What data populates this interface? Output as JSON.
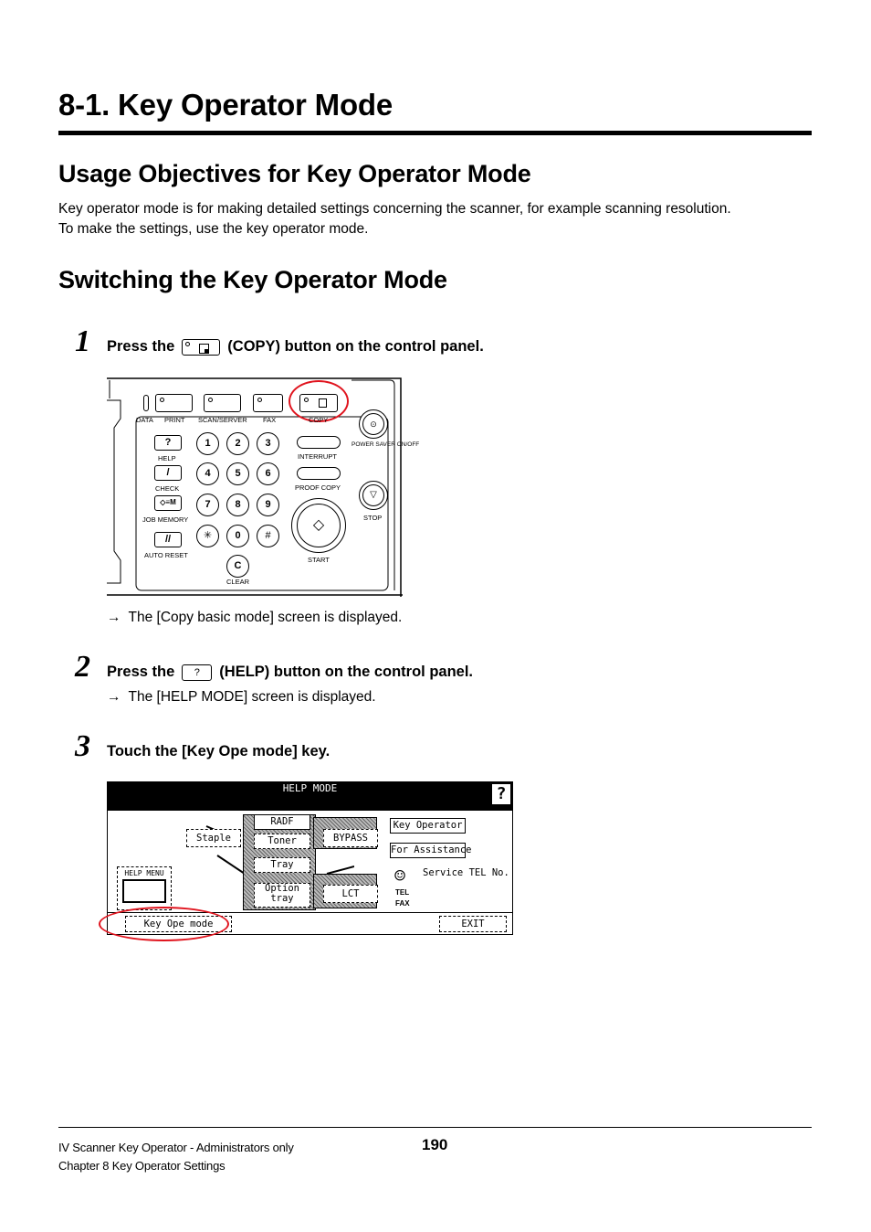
{
  "document": {
    "title": "8-1. Key Operator Mode",
    "sections": [
      {
        "heading": "Usage Objectives for Key Operator Mode",
        "paragraphs": [
          "Key operator mode is for making detailed settings concerning the scanner, for example scanning resolution.",
          "To make the settings, use the key operator mode."
        ]
      },
      {
        "heading": "Switching the Key Operator Mode"
      }
    ],
    "steps": [
      {
        "number": "1",
        "prefix": "Press the",
        "suffix": "(COPY) button on the control panel.",
        "icon": "copy-button-icon",
        "result": "The [Copy basic mode] screen is displayed."
      },
      {
        "number": "2",
        "prefix": "Press the",
        "key_label": "?",
        "suffix": "(HELP) button on the control panel.",
        "icon": "help-button-icon",
        "result": "The [HELP MODE] screen is displayed."
      },
      {
        "number": "3",
        "text": "Touch the [Key Ope mode] key."
      }
    ],
    "result_arrow": "→"
  },
  "control_panel": {
    "mode_keys": [
      "DATA",
      "PRINT",
      "SCAN/SERVER",
      "FAX",
      "COPY"
    ],
    "left_keys": [
      {
        "symbol": "?",
        "label": "HELP"
      },
      {
        "symbol": "/",
        "label": "CHECK"
      },
      {
        "symbol": "◇≡M",
        "label": "JOB MEMORY"
      },
      {
        "symbol": "//",
        "label": "AUTO RESET"
      }
    ],
    "keypad": [
      "1",
      "2",
      "3",
      "4",
      "5",
      "6",
      "7",
      "8",
      "9",
      "✳",
      "0",
      "#"
    ],
    "clear_key": {
      "symbol": "C",
      "label": "CLEAR"
    },
    "interrupt_label": "INTERRUPT",
    "proof_copy_label": "PROOF COPY",
    "start_label": "START",
    "start_symbol": "◇",
    "power_saver_label": "POWER SAVER ON/OFF",
    "stop_label": "STOP",
    "highlighted_key": "COPY",
    "highlight_color": "#e0141e"
  },
  "help_screen": {
    "header": "HELP MODE",
    "help_glyph": "?",
    "machine_buttons": [
      "RADF",
      "Toner",
      "Tray",
      "Option tray",
      "Staple",
      "BYPASS",
      "LCT"
    ],
    "key_operator": "Key Operator",
    "for_assistance": "For Assistance",
    "service_tel": "Service TEL No.",
    "tel": "TEL",
    "fax": "FAX",
    "help_menu": "HELP MENU",
    "key_ope_mode": "Key Ope mode",
    "exit": "EXIT",
    "highlighted_key": "Key Ope mode"
  },
  "footer": {
    "line1": "IV Scanner Key Operator - Administrators only",
    "line2": "Chapter 8 Key Operator Settings",
    "page_number": "190"
  }
}
